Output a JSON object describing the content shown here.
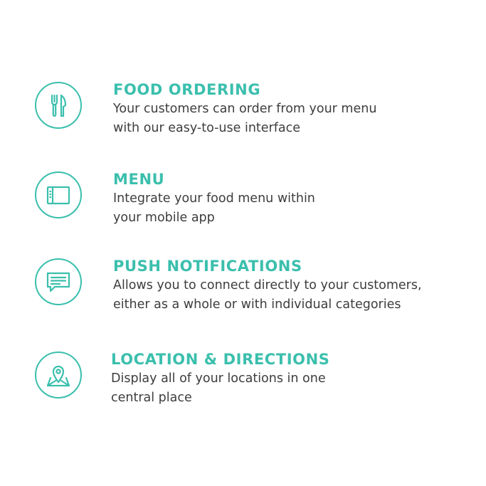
{
  "features": [
    {
      "icon": "fork-knife-icon",
      "title": "FOOD ORDERING",
      "description": "Your customers can order from your menu\nwith our easy-to-use interface"
    },
    {
      "icon": "menu-book-icon",
      "title": "MENU",
      "description": "Integrate your food menu within\nyour mobile app"
    },
    {
      "icon": "chat-bubble-icon",
      "title": "PUSH  NOTIFICATIONS",
      "description": "Allows you to connect directly to your customers,\neither as a whole or with individual categories"
    },
    {
      "icon": "map-pin-icon",
      "title": "LOCATION & DIRECTIONS",
      "description": "Display all of your locations in one\ncentral place"
    }
  ],
  "colors": {
    "accent": "#3bbfad",
    "text": "#3d3d3d",
    "background": "#ffffff"
  }
}
